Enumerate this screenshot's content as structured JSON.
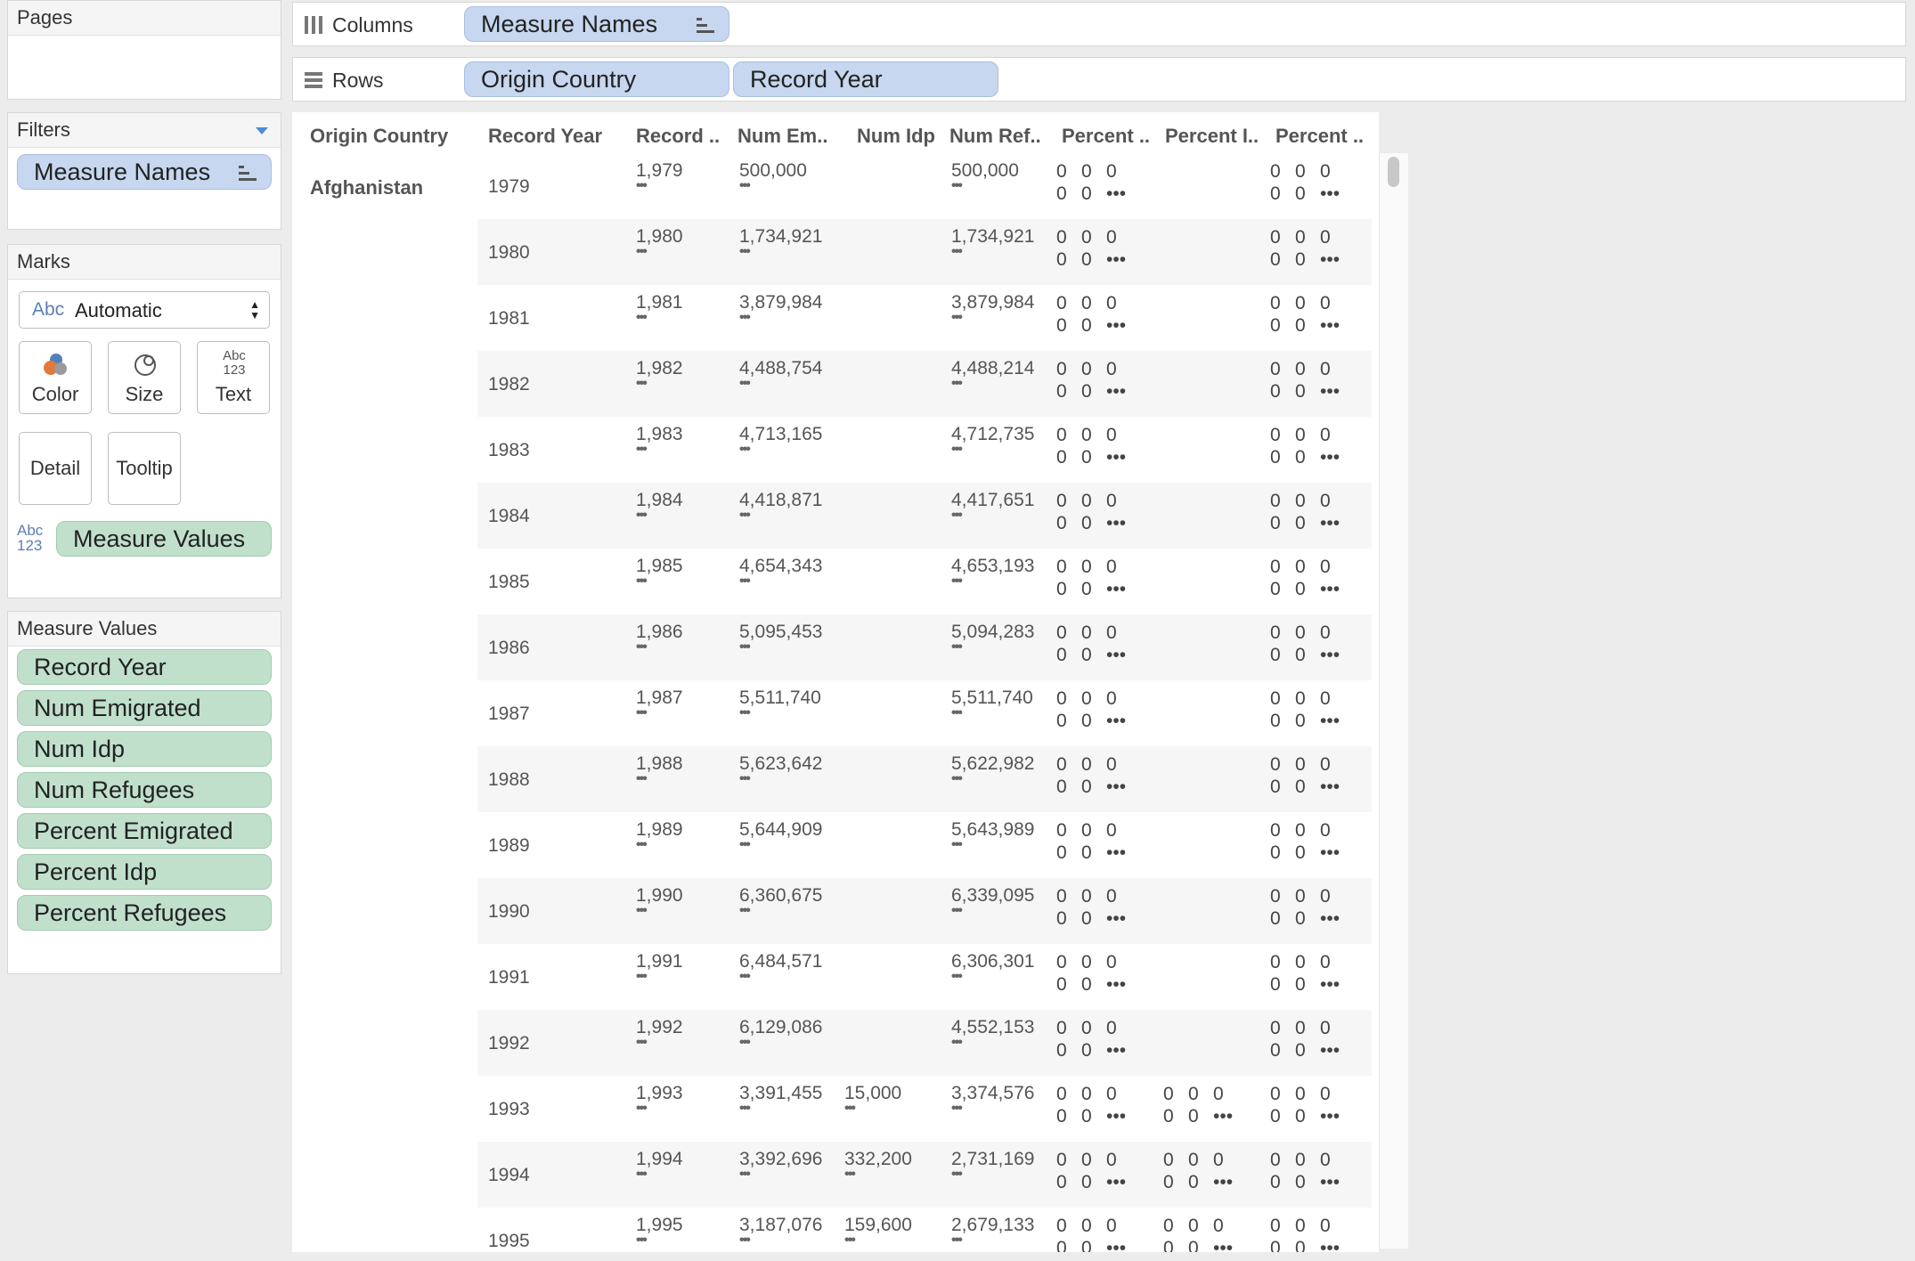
{
  "pages": {
    "title": "Pages"
  },
  "filters": {
    "title": "Filters",
    "pill": "Measure Names"
  },
  "marks": {
    "title": "Marks",
    "mark_type": {
      "prefix": "Abc",
      "value": "Automatic"
    },
    "buttons": {
      "color": "Color",
      "size": "Size",
      "text": "Text",
      "detail": "Detail",
      "tooltip": "Tooltip"
    },
    "text_icon": "Abc 123",
    "pill": "Measure Values"
  },
  "measure_values": {
    "title": "Measure Values",
    "items": [
      "Record Year",
      "Num Emigrated",
      "Num Idp",
      "Num Refugees",
      "Percent Emigrated",
      "Percent Idp",
      "Percent Refugees"
    ]
  },
  "shelves": {
    "columns": {
      "label": "Columns",
      "pills": [
        "Measure Names"
      ]
    },
    "rows": {
      "label": "Rows",
      "pills": [
        "Origin Country",
        "Record Year"
      ]
    }
  },
  "table": {
    "headers": [
      "Origin Country",
      "Record Year",
      "Record ..",
      "Num Em..",
      "Num Idp",
      "Num Ref..",
      "Percent ..",
      "Percent I..",
      "Percent .."
    ],
    "country": "Afghanistan",
    "pct_row1": [
      "0",
      "0",
      "0"
    ],
    "pct_row2": [
      "0",
      "0",
      "•••"
    ],
    "rows": [
      {
        "year": "1979",
        "record": "1,979",
        "emig": "500,000",
        "idp": "",
        "ref": "500,000",
        "pidp": false
      },
      {
        "year": "1980",
        "record": "1,980",
        "emig": "1,734,921",
        "idp": "",
        "ref": "1,734,921",
        "pidp": false
      },
      {
        "year": "1981",
        "record": "1,981",
        "emig": "3,879,984",
        "idp": "",
        "ref": "3,879,984",
        "pidp": false
      },
      {
        "year": "1982",
        "record": "1,982",
        "emig": "4,488,754",
        "idp": "",
        "ref": "4,488,214",
        "pidp": false
      },
      {
        "year": "1983",
        "record": "1,983",
        "emig": "4,713,165",
        "idp": "",
        "ref": "4,712,735",
        "pidp": false
      },
      {
        "year": "1984",
        "record": "1,984",
        "emig": "4,418,871",
        "idp": "",
        "ref": "4,417,651",
        "pidp": false
      },
      {
        "year": "1985",
        "record": "1,985",
        "emig": "4,654,343",
        "idp": "",
        "ref": "4,653,193",
        "pidp": false
      },
      {
        "year": "1986",
        "record": "1,986",
        "emig": "5,095,453",
        "idp": "",
        "ref": "5,094,283",
        "pidp": false
      },
      {
        "year": "1987",
        "record": "1,987",
        "emig": "5,511,740",
        "idp": "",
        "ref": "5,511,740",
        "pidp": false
      },
      {
        "year": "1988",
        "record": "1,988",
        "emig": "5,623,642",
        "idp": "",
        "ref": "5,622,982",
        "pidp": false
      },
      {
        "year": "1989",
        "record": "1,989",
        "emig": "5,644,909",
        "idp": "",
        "ref": "5,643,989",
        "pidp": false
      },
      {
        "year": "1990",
        "record": "1,990",
        "emig": "6,360,675",
        "idp": "",
        "ref": "6,339,095",
        "pidp": false
      },
      {
        "year": "1991",
        "record": "1,991",
        "emig": "6,484,571",
        "idp": "",
        "ref": "6,306,301",
        "pidp": false
      },
      {
        "year": "1992",
        "record": "1,992",
        "emig": "6,129,086",
        "idp": "",
        "ref": "4,552,153",
        "pidp": false
      },
      {
        "year": "1993",
        "record": "1,993",
        "emig": "3,391,455",
        "idp": "15,000",
        "ref": "3,374,576",
        "pidp": true
      },
      {
        "year": "1994",
        "record": "1,994",
        "emig": "3,392,696",
        "idp": "332,200",
        "ref": "2,731,169",
        "pidp": true
      },
      {
        "year": "1995",
        "record": "1,995",
        "emig": "3,187,076",
        "idp": "159,600",
        "ref": "2,679,133",
        "pidp": true
      }
    ]
  }
}
